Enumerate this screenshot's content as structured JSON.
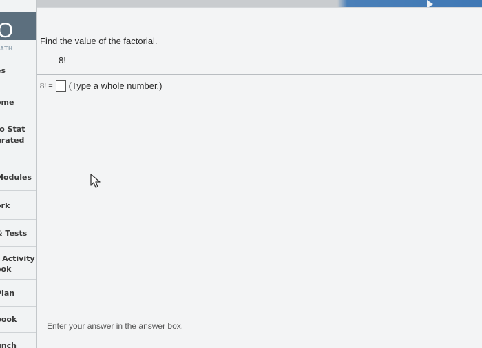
{
  "window": {
    "accent_color": "#3f78b5",
    "forward_icon": "play-arrow-icon"
  },
  "sidebar": {
    "logo_text": "O",
    "logo_sub": "ATH",
    "items": [
      {
        "label": "es"
      },
      {
        "label": "ome"
      },
      {
        "label": "to Stat"
      },
      {
        "label": "grated"
      },
      {
        "label": "Modules"
      },
      {
        "label": "ork"
      },
      {
        "label": "& Tests"
      },
      {
        "label": "t Activity"
      },
      {
        "label": "ook"
      },
      {
        "label": "Plan"
      },
      {
        "label": "book"
      },
      {
        "label": "unch"
      }
    ]
  },
  "question": {
    "title": "Find the value of the factorial.",
    "expression": "8!",
    "answer_lhs": "8! =",
    "answer_value": "",
    "answer_hint": "(Type a whole number.)"
  },
  "footer": {
    "message": "Enter your answer in the answer box."
  },
  "cursor": {
    "icon": "mouse-pointer-icon"
  }
}
